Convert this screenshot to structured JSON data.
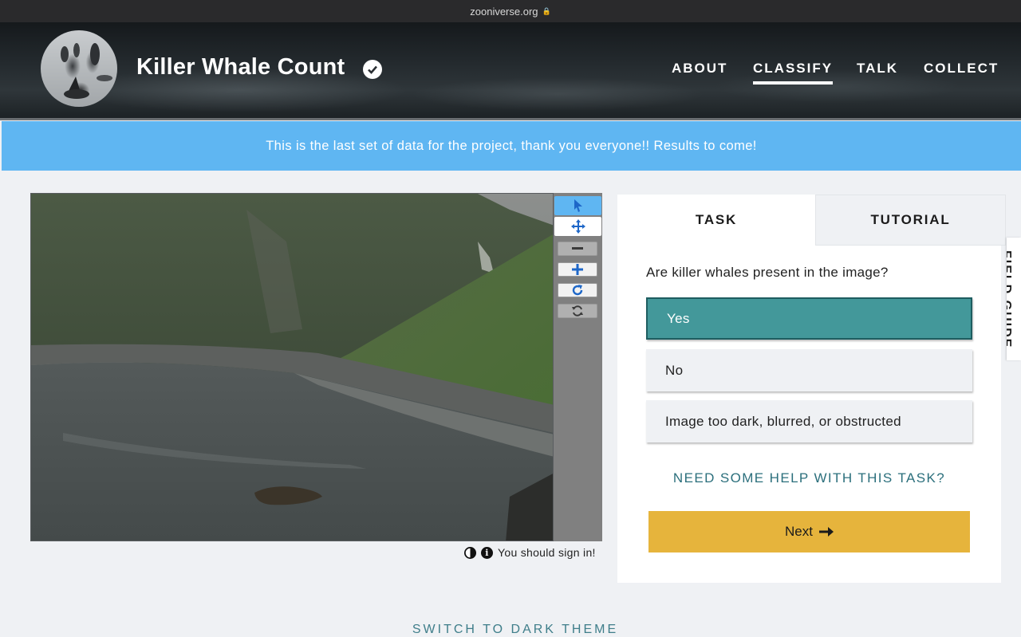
{
  "browser": {
    "url": "zooniverse.org"
  },
  "header": {
    "title": "Killer Whale Count",
    "nav": [
      {
        "label": "ABOUT",
        "active": false
      },
      {
        "label": "CLASSIFY",
        "active": true
      },
      {
        "label": "TALK",
        "active": false
      },
      {
        "label": "COLLECT",
        "active": false
      }
    ]
  },
  "banner": {
    "text": "This is the last set of data for the project, thank you everyone!! Results to come!"
  },
  "viewer": {
    "tools": [
      "pointer-icon",
      "move-icon",
      "zoom-out-icon",
      "zoom-in-icon",
      "rotate-icon",
      "reset-icon"
    ],
    "sign_in_text": "You should sign in!"
  },
  "task_panel": {
    "tabs": {
      "task": "TASK",
      "tutorial": "TUTORIAL"
    },
    "question": "Are killer whales present in the image?",
    "answers": [
      {
        "label": "Yes",
        "selected": true
      },
      {
        "label": "No",
        "selected": false
      },
      {
        "label": "Image too dark, blurred, or obstructed",
        "selected": false
      }
    ],
    "help_link": "NEED SOME HELP WITH THIS TASK?",
    "next_label": "Next"
  },
  "field_guide": {
    "label": "FIELD GUIDE"
  },
  "footer": {
    "dark_theme_link": "SWITCH TO DARK THEME"
  },
  "colors": {
    "banner": "#5fb6f2",
    "selected_answer": "#43989a",
    "next_button": "#e6b43c",
    "help_link": "#2b6f7c"
  }
}
